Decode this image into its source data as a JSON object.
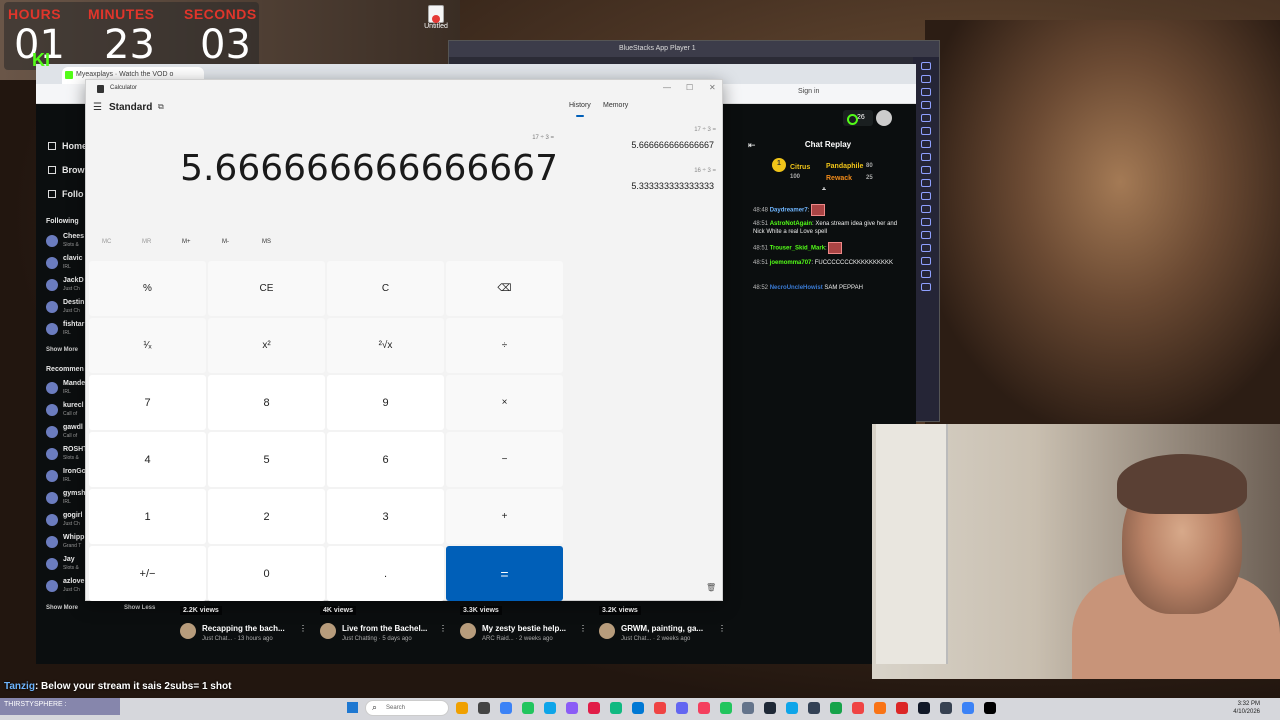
{
  "timer": {
    "hours_label": "HOURS",
    "minutes_label": "MINUTES",
    "seconds_label": "SECONDS",
    "hours": "01",
    "minutes": "23",
    "seconds": "03"
  },
  "desktop": {
    "icon_label": "Untitled"
  },
  "back_window": {
    "title": "BlueStacks App Player 1"
  },
  "browser": {
    "tab_title": "Myeaxplays · Watch the VOD o",
    "signin": "Sign in",
    "viewer_count": "26"
  },
  "kick_sidebar": {
    "logo": "KI",
    "nav": [
      "Home",
      "Brow",
      "Follo"
    ],
    "following_label": "Following",
    "following": [
      {
        "name": "Chees",
        "sub": "Slots &"
      },
      {
        "name": "clavic",
        "sub": "IRL"
      },
      {
        "name": "JackD",
        "sub": "Just Ch"
      },
      {
        "name": "Destin",
        "sub": "Just Ch"
      },
      {
        "name": "fishtar",
        "sub": "IRL"
      }
    ],
    "show_more": "Show More",
    "recommended_label": "Recommen",
    "recommended": [
      {
        "name": "Mande",
        "sub": "IRL"
      },
      {
        "name": "kurecl",
        "sub": "Call of"
      },
      {
        "name": "gawdl",
        "sub": "Call of"
      },
      {
        "name": "ROSHT",
        "sub": "Slots &"
      },
      {
        "name": "IronGo",
        "sub": "IRL"
      },
      {
        "name": "gymsh",
        "sub": "IRL"
      },
      {
        "name": "gogirl",
        "sub": "Just Ch"
      },
      {
        "name": "Whipp",
        "sub": "Grand T"
      },
      {
        "name": "Jay",
        "sub": "Slots &"
      },
      {
        "name": "azlove",
        "sub": "Just Ch"
      }
    ],
    "show_more_2": "Show More",
    "show_less": "Show Less"
  },
  "chat": {
    "title": "Chat Replay",
    "gifters": [
      {
        "name": "Citrus",
        "count": "100"
      },
      {
        "name": "Pandaphile",
        "count": "80"
      },
      {
        "name": "Rewack",
        "count": "25"
      }
    ],
    "rank": "1",
    "messages": [
      {
        "time": "48:48",
        "user": "Daydreamer7",
        "text": ":"
      },
      {
        "time": "48:51",
        "user": "AstroNotAgain",
        "text": ": Xena stream idea give her and Nick White a real Love spell"
      },
      {
        "time": "48:51",
        "user": "Trouser_Skid_Mark",
        "text": ":"
      },
      {
        "time": "48:51",
        "user": "joemomma707",
        "text": ": FUCCCCCCCKKKKKKKKKK"
      },
      {
        "time": "48:52",
        "user": "NecroUncleHowist",
        "text": " SAM PEPPAH"
      }
    ]
  },
  "vods": [
    {
      "views": "2.2K views",
      "title": "Recapping the bach...",
      "sub": "Just Chat... · 13 hours ago"
    },
    {
      "views": "4K views",
      "title": "Live from the Bachel...",
      "sub": "Just Chatting · 5 days ago"
    },
    {
      "views": "3.3K views",
      "title": "My zesty bestie help...",
      "sub": "ARC Raid... · 2 weeks ago"
    },
    {
      "views": "3.2K views",
      "title": "GRWM, painting, ga...",
      "sub": "Just Chat... · 2 weeks ago"
    }
  ],
  "calculator": {
    "title": "Calculator",
    "mode": "Standard",
    "tabs": {
      "history": "History",
      "memory": "Memory"
    },
    "expression": "17 ÷ 3 =",
    "display": "5.666666666666667",
    "history": [
      {
        "expr": "17  ÷  3 =",
        "result": "5.666666666666667"
      },
      {
        "expr": "16  ÷  3 =",
        "result": "5.333333333333333"
      }
    ],
    "memory_keys": [
      "MC",
      "MR",
      "M+",
      "M-",
      "MS"
    ],
    "keys": [
      [
        "%",
        "CE",
        "C",
        "⌫"
      ],
      [
        "¹⁄ₓ",
        "x²",
        "²√x",
        "÷"
      ],
      [
        "7",
        "8",
        "9",
        "×"
      ],
      [
        "4",
        "5",
        "6",
        "−"
      ],
      [
        "1",
        "2",
        "3",
        "+"
      ],
      [
        "+/−",
        "0",
        ".",
        "="
      ]
    ]
  },
  "overlay_chat": {
    "user": "Tanzig",
    "text": ": Below your stream it sais 2subs= 1 shot"
  },
  "overlay_strip": {
    "text": "THIRSTYSPHERE :"
  },
  "taskbar": {
    "search": "Search",
    "time": "3:32 PM",
    "date": "4/10/2026"
  }
}
